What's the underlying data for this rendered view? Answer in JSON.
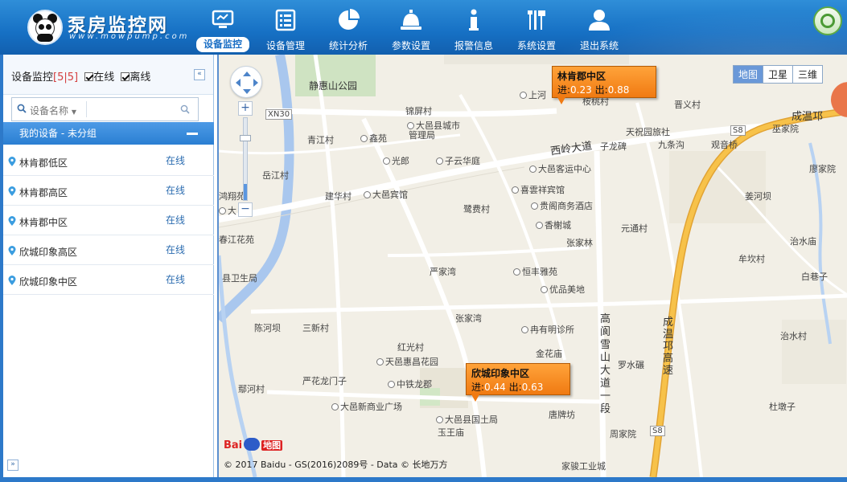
{
  "header": {
    "brand_title": "泵房监控网",
    "brand_subtitle": "www.mowpump.com",
    "nav": [
      {
        "label": "设备监控",
        "icon": "monitor-icon"
      },
      {
        "label": "设备管理",
        "icon": "list-icon"
      },
      {
        "label": "统计分析",
        "icon": "pie-chart-icon"
      },
      {
        "label": "参数设置",
        "icon": "bell-icon"
      },
      {
        "label": "报警信息",
        "icon": "info-icon"
      },
      {
        "label": "系统设置",
        "icon": "tools-icon"
      },
      {
        "label": "退出系统",
        "icon": "user-icon"
      }
    ],
    "active_nav": "设备监控",
    "search_icon": "search-icon"
  },
  "sidebar": {
    "title": "设备监控",
    "count_open": "[",
    "online_count": "5",
    "sep": "|",
    "total_count": "5",
    "count_close": "]",
    "online_label": "在线",
    "offline_label": "离线",
    "search_placeholder": "设备名称",
    "group_label": "我的设备 - 未分组",
    "devices": [
      {
        "name": "林肯郡低区",
        "status": "在线"
      },
      {
        "name": "林肯郡高区",
        "status": "在线"
      },
      {
        "name": "林肯郡中区",
        "status": "在线"
      },
      {
        "name": "欣城印象高区",
        "status": "在线"
      },
      {
        "name": "欣城印象中区",
        "status": "在线"
      }
    ]
  },
  "map": {
    "map_types": [
      "地图",
      "卫星",
      "三维"
    ],
    "callouts": [
      {
        "title": "林肯郡中区",
        "in_label": "进:",
        "in_value": "0.23",
        "out_label": "出:",
        "out_value": "0.88"
      },
      {
        "title": "欣城印象中区",
        "in_label": "进:",
        "in_value": "0.44",
        "out_label": "出:",
        "out_value": "0.63"
      }
    ],
    "labels": {
      "l1": "静惠山公园",
      "l2": "XN30",
      "l3": "锦屏村",
      "l4": "大邑县城市",
      "l5": "管理局",
      "l6": "青江村",
      "l7": "鑫苑",
      "l8": "光郎",
      "l9": "子云华庭",
      "l10": "西岭大道",
      "l11": "大邑客运中心",
      "l12": "岳江村",
      "l13": "建华村",
      "l14": "大邑宾馆",
      "l15": "喜雲祥宾馆",
      "l16": "贵阁商务酒店",
      "l17": "鹭费村",
      "l18": "香榭城",
      "l19": "张家林",
      "l20": "元通村",
      "l21": "鸿翔苑",
      "l22": "春江花苑",
      "l23": "严家湾",
      "l24": "恒丰雅苑",
      "l25": "优品美地",
      "l26": "县卫生局",
      "l27": "张家湾",
      "l28": "陈河坝",
      "l29": "三新村",
      "l30": "冉有明诊所",
      "l31": "金花庙",
      "l32": "红光村",
      "l33": "天邑惠昌花园",
      "l34": "严花龙门子",
      "l35": "中铁龙郡",
      "l36": "鄢河村",
      "l37": "大邑新商业广场",
      "l38": "大邑县国土局",
      "l39": "玉王庙",
      "l40": "唐牌坊",
      "l41": "罗水碾",
      "l42": "周家院",
      "l43": "家骏工业城",
      "l44": "成温邛高速",
      "l45": "高阆雪山大道一段",
      "l46": "晋义村",
      "l47": "天祝园旅社",
      "l48": "九条沟",
      "l49": "观音桥",
      "l50": "巫家院",
      "l51": "廖家院",
      "l52": "姜河坝",
      "l53": "治水庙",
      "l54": "牟坎村",
      "l55": "白巷子",
      "l56": "治水村",
      "l57": "杜墩子",
      "l58": "上河",
      "l59": "桉桃村",
      "l60": "子龙碑",
      "l61": "成温邛",
      "l62": "S8",
      "l63": "大"
    },
    "baidu_logo_text": "Bai",
    "baidu_logo_map": "地图",
    "copyright": "© 2017 Baidu - GS(2016)2089号 - Data © 长地万方"
  }
}
